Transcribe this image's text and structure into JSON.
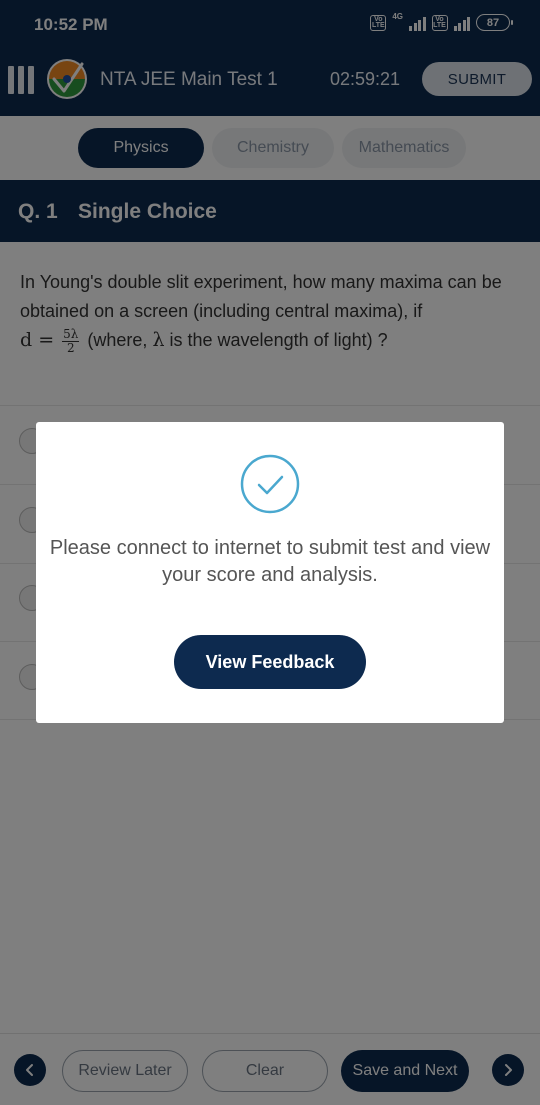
{
  "status_bar": {
    "time": "10:52 PM",
    "network_label": "4G",
    "volte_label": "Vo LTE",
    "battery": "87"
  },
  "app_bar": {
    "title": "NTA JEE Main Test 1",
    "timer": "02:59:21",
    "submit_label": "SUBMIT"
  },
  "tabs": [
    {
      "label": "Physics",
      "active": true
    },
    {
      "label": "Chemistry",
      "active": false
    },
    {
      "label": "Mathematics",
      "active": false
    }
  ],
  "question": {
    "number": "Q. 1",
    "type": "Single Choice",
    "text_part1": "In Young's double slit experiment, how many maxima can be obtained on a screen (including central maxima), if",
    "math_lhs": "d =",
    "frac_num": "5λ",
    "frac_den": "2",
    "text_part2": "(where,",
    "lambda": "λ",
    "text_part3": "is the wavelength of light) ?"
  },
  "modal": {
    "icon": "check-circle-icon",
    "message": "Please connect to internet to submit test and view your score and analysis.",
    "button_label": "View Feedback"
  },
  "bottom_bar": {
    "review_label": "Review Later",
    "clear_label": "Clear",
    "save_label": "Save and Next"
  },
  "colors": {
    "primary": "#0d2a4f",
    "accent_check": "#4aa8cf",
    "overlay": "rgba(0,0,0,0.5)"
  }
}
